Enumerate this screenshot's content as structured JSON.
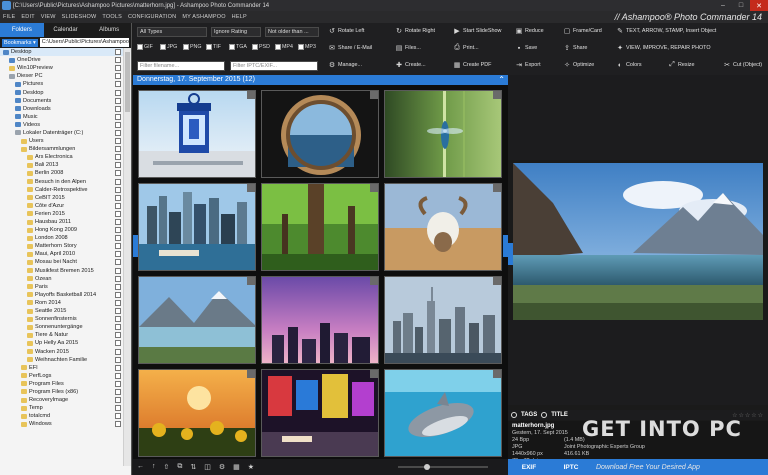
{
  "window": {
    "title": "[C:\\Users\\Public\\Pictures\\Ashampoo Pictures\\matterhorn.jpg] - Ashampoo Photo Commander 14",
    "controls": [
      "–",
      "□",
      "✕"
    ]
  },
  "menu": {
    "items": [
      "FILE",
      "EDIT",
      "VIEW",
      "SLIDESHOW",
      "TOOLS",
      "CONFIGURATION",
      "MY ASHAMPOO",
      "HELP"
    ],
    "brand": "// Ashampoo® Photo Commander 14"
  },
  "left_panel": {
    "tabs": [
      "Folders",
      "Calendar",
      "Albums"
    ],
    "bookmarks_label": "Bookmarks ▾",
    "path": "C:\\Users\\Public\\Pictures\\Ashampoo",
    "tree": [
      {
        "label": "Desktop",
        "level": 0,
        "icon": "blue",
        "selected": true
      },
      {
        "label": "OneDrive",
        "level": 1,
        "icon": "blue"
      },
      {
        "label": "Win10Preview",
        "level": 1,
        "icon": "folder"
      },
      {
        "label": "Dieser PC",
        "level": 1,
        "icon": "drive"
      },
      {
        "label": "Pictures",
        "level": 2,
        "icon": "blue"
      },
      {
        "label": "Desktop",
        "level": 2,
        "icon": "blue"
      },
      {
        "label": "Documents",
        "level": 2,
        "icon": "blue"
      },
      {
        "label": "Downloads",
        "level": 2,
        "icon": "blue"
      },
      {
        "label": "Music",
        "level": 2,
        "icon": "blue"
      },
      {
        "label": "Videos",
        "level": 2,
        "icon": "blue"
      },
      {
        "label": "Lokaler Datenträger (C:)",
        "level": 2,
        "icon": "drive"
      },
      {
        "label": "Users",
        "level": 3,
        "icon": "folder"
      },
      {
        "label": "Bildersammlungen",
        "level": 3,
        "icon": "folder"
      },
      {
        "label": "Ars Electronica",
        "level": 4,
        "icon": "folder"
      },
      {
        "label": "Bali 2013",
        "level": 4,
        "icon": "folder"
      },
      {
        "label": "Berlin 2008",
        "level": 4,
        "icon": "folder"
      },
      {
        "label": "Besuch in den Alpen",
        "level": 4,
        "icon": "folder"
      },
      {
        "label": "Calder-Retrospektive",
        "level": 4,
        "icon": "folder"
      },
      {
        "label": "CeBIT 2015",
        "level": 4,
        "icon": "folder"
      },
      {
        "label": "Côte d'Azur",
        "level": 4,
        "icon": "folder"
      },
      {
        "label": "Ferien 2015",
        "level": 4,
        "icon": "folder"
      },
      {
        "label": "Hausbau 2011",
        "level": 4,
        "icon": "folder"
      },
      {
        "label": "Hong Kong 2009",
        "level": 4,
        "icon": "folder"
      },
      {
        "label": "London 2008",
        "level": 4,
        "icon": "folder"
      },
      {
        "label": "Matterhorn Story",
        "level": 4,
        "icon": "folder"
      },
      {
        "label": "Maui, April 2010",
        "level": 4,
        "icon": "folder"
      },
      {
        "label": "Mosau bei Nacht",
        "level": 4,
        "icon": "folder"
      },
      {
        "label": "Musikfest Bremen 2015",
        "level": 4,
        "icon": "folder"
      },
      {
        "label": "Ozean",
        "level": 4,
        "icon": "folder"
      },
      {
        "label": "Paris",
        "level": 4,
        "icon": "folder"
      },
      {
        "label": "Playoffs Basketball 2014",
        "level": 4,
        "icon": "folder"
      },
      {
        "label": "Rom 2014",
        "level": 4,
        "icon": "folder"
      },
      {
        "label": "Seattle 2015",
        "level": 4,
        "icon": "folder"
      },
      {
        "label": "Sonnenfinsternis",
        "level": 4,
        "icon": "folder"
      },
      {
        "label": "Sonnenuntergänge",
        "level": 4,
        "icon": "folder"
      },
      {
        "label": "Tiere & Natur",
        "level": 4,
        "icon": "folder"
      },
      {
        "label": "Up Helly Aa 2015",
        "level": 4,
        "icon": "folder"
      },
      {
        "label": "Wacken 2015",
        "level": 4,
        "icon": "folder"
      },
      {
        "label": "Weihnachten Familie",
        "level": 4,
        "icon": "folder"
      },
      {
        "label": "EFI",
        "level": 3,
        "icon": "folder"
      },
      {
        "label": "PerfLogs",
        "level": 3,
        "icon": "folder"
      },
      {
        "label": "Program Files",
        "level": 3,
        "icon": "folder"
      },
      {
        "label": "Program Files (x86)",
        "level": 3,
        "icon": "folder"
      },
      {
        "label": "RecoveryImage",
        "level": 3,
        "icon": "folder"
      },
      {
        "label": "Temp",
        "level": 3,
        "icon": "folder"
      },
      {
        "label": "totalcmd",
        "level": 3,
        "icon": "folder"
      },
      {
        "label": "Windows",
        "level": 3,
        "icon": "folder"
      }
    ]
  },
  "filters": {
    "type": "All Types",
    "rating": "Ignore Rating",
    "age": "Not older than ...",
    "name_placeholder": "Filter filename...",
    "iptc_placeholder": "Filter IPTC/EXIF...",
    "formats": [
      "GIF",
      "JPG",
      "PNG",
      "TIF",
      "TGA",
      "PSD",
      "MP4",
      "MP3"
    ]
  },
  "toolbar": {
    "buttons": [
      {
        "label": "Rotate Left",
        "icon": "rotate-left-icon",
        "glyph": "↺"
      },
      {
        "label": "Rotate Right",
        "icon": "rotate-right-icon",
        "glyph": "↻"
      },
      {
        "label": "Start SlideShow",
        "icon": "slideshow-icon",
        "glyph": "▶"
      },
      {
        "label": "Reduce",
        "icon": "reduce-icon",
        "glyph": "▣"
      },
      {
        "label": "Frame/Card",
        "icon": "frame-icon",
        "glyph": "▢"
      },
      {
        "label": "TEXT, ARROW, STAMP, Insert Object",
        "icon": "text-icon",
        "glyph": "✎"
      },
      {
        "label": "Share / E-Mail",
        "icon": "share-mail-icon",
        "glyph": "✉"
      },
      {
        "label": "Files...",
        "icon": "files-icon",
        "glyph": "▤"
      },
      {
        "label": "Print...",
        "icon": "print-icon",
        "glyph": "⎙"
      },
      {
        "label": "Save",
        "icon": "save-icon",
        "glyph": "▪"
      },
      {
        "label": "Share",
        "icon": "share-icon",
        "glyph": "⇪"
      },
      {
        "label": "VIEW, IMPROVE, REPAIR PHOTO",
        "icon": "view-improve-icon",
        "glyph": "✦"
      },
      {
        "label": "Manage...",
        "icon": "manage-icon",
        "glyph": "⚙"
      },
      {
        "label": "Create...",
        "icon": "create-icon",
        "glyph": "✚"
      },
      {
        "label": "Create PDF",
        "icon": "pdf-icon",
        "glyph": "▦"
      },
      {
        "label": "Export",
        "icon": "export-icon",
        "glyph": "⇥"
      },
      {
        "label": "Optimize",
        "icon": "optimize-icon",
        "glyph": "✧"
      },
      {
        "label": "Colors",
        "icon": "colors-icon",
        "glyph": "◐"
      },
      {
        "label": "Resize",
        "icon": "resize-icon",
        "glyph": "⤢"
      },
      {
        "label": "Cut (Object)",
        "icon": "cut-icon",
        "glyph": "✂"
      }
    ]
  },
  "gallery": {
    "date_header": "Donnerstag, 17. September 2015 (12)",
    "collapse_glyph": "⌃"
  },
  "bottombar": {
    "icons": [
      {
        "name": "back-icon",
        "glyph": "←"
      },
      {
        "name": "up-icon",
        "glyph": "↑"
      },
      {
        "name": "folder-up-icon",
        "glyph": "⇧"
      },
      {
        "name": "copy-icon",
        "glyph": "⧉"
      },
      {
        "name": "sort-icon",
        "glyph": "⇅"
      },
      {
        "name": "view-mode-icon",
        "glyph": "◫"
      },
      {
        "name": "settings-icon",
        "glyph": "⚙"
      },
      {
        "name": "grid-icon",
        "glyph": "▦"
      },
      {
        "name": "star-icon",
        "glyph": "★"
      }
    ]
  },
  "preview": {
    "tags_label": "TAGS",
    "title_label": "TITLE",
    "stars": "☆☆☆☆☆",
    "filename": "matterhorn.jpg",
    "info_rows": [
      {
        "a": "Gestern, 17. Sept 2015",
        "b": "",
        "c": ""
      },
      {
        "a": "24 Bpp",
        "b": "(1.4 MB)",
        "c": ""
      },
      {
        "a": "JPG",
        "b": "Joint Photographic Experts Group",
        "c": ""
      },
      {
        "a": "1440x960 px",
        "b": "416.61 KB",
        "c": ""
      },
      {
        "a": "72 x 72 dpi",
        "b": "",
        "c": ""
      }
    ],
    "tabs": [
      "EXIF",
      "IPTC"
    ],
    "download_text": "Download Free Your Desired App"
  },
  "watermark": "GET INTO PC"
}
